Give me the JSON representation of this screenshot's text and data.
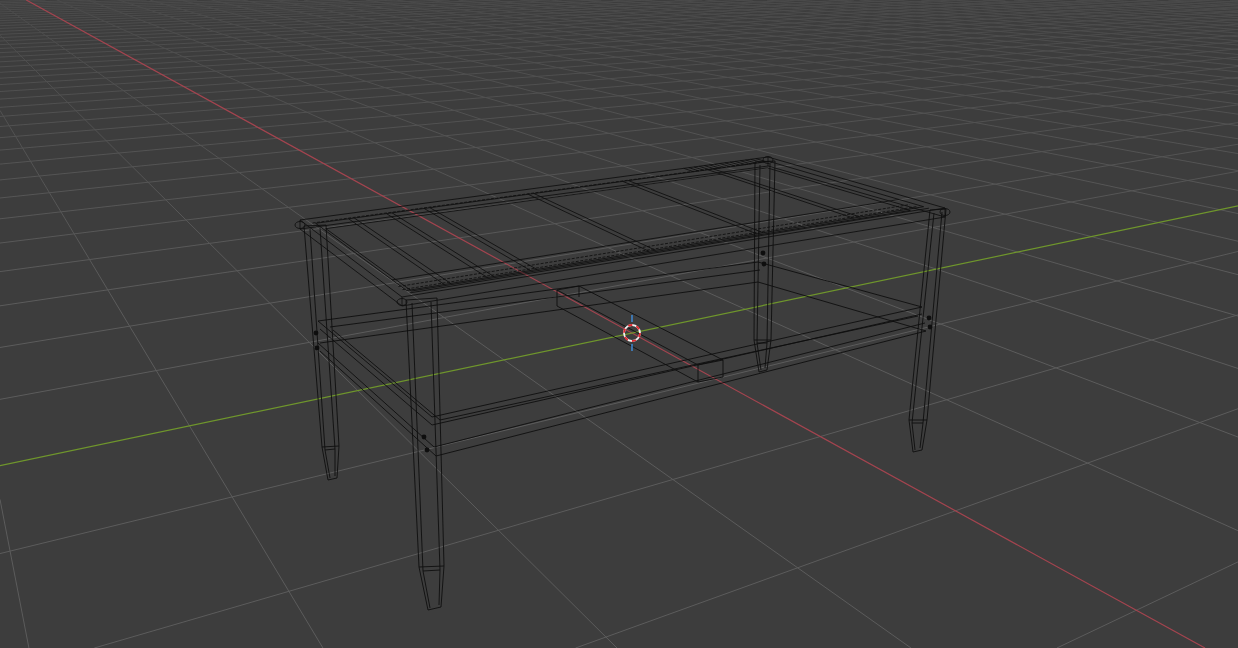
{
  "viewport": {
    "wireframe": true,
    "floor_grid": true,
    "axis_x": true,
    "axis_y": true,
    "cursor": true
  }
}
